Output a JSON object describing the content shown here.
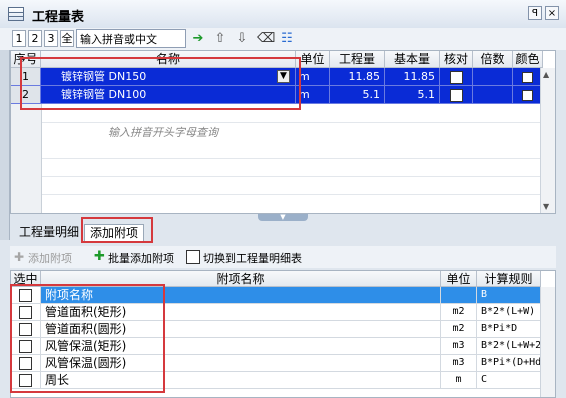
{
  "window": {
    "title": "工程量表",
    "pin_glyph": "ꟼ",
    "close_glyph": "×"
  },
  "toolbar": {
    "levels": [
      "1",
      "2",
      "3",
      "全"
    ],
    "search_value": "输入拼音或中文",
    "icons": [
      "arrow-right-icon",
      "arrow-up-icon",
      "arrow-down-icon",
      "clear-icon",
      "list-check-icon"
    ]
  },
  "grid": {
    "headers": [
      "序号",
      "名称",
      "单位",
      "工程量",
      "基本量",
      "核对",
      "倍数",
      "颜色"
    ],
    "rows": [
      {
        "no": "1",
        "name": "镀锌钢管 DN150",
        "unit": "m",
        "quantity": "11.85",
        "base": "11.85"
      },
      {
        "no": "2",
        "name": "镀锌钢管 DN100",
        "unit": "m",
        "quantity": "5.1",
        "base": "5.1"
      }
    ],
    "hint": "输入拼音开头字母查询"
  },
  "tabs": [
    {
      "label": "工程量明细",
      "active": false
    },
    {
      "label": "添加附项",
      "active": true
    }
  ],
  "sub_toolbar": {
    "add_item": "添加附项",
    "batch_add": "批量添加附项",
    "switch_label": "切换到工程量明细表"
  },
  "grid2": {
    "headers": [
      "选中",
      "附项名称",
      "单位",
      "计算规则"
    ],
    "rows": [
      {
        "name": "附项名称",
        "unit": "",
        "rule": "B",
        "selected": true
      },
      {
        "name": "管道面积(矩形)",
        "unit": "m2",
        "rule": "B*2*(L+W)"
      },
      {
        "name": "管道面积(圆形)",
        "unit": "m2",
        "rule": "B*Pi*D"
      },
      {
        "name": "风管保温(矩形)",
        "unit": "m3",
        "rule": "B*2*(L+W+2"
      },
      {
        "name": "风管保温(圆形)",
        "unit": "m3",
        "rule": "B*Pi*(D+Hd"
      },
      {
        "name": "周长",
        "unit": "m",
        "rule": "C"
      }
    ]
  },
  "colors": {
    "selection": "#0a2bd6",
    "highlight": "#d5393d"
  }
}
